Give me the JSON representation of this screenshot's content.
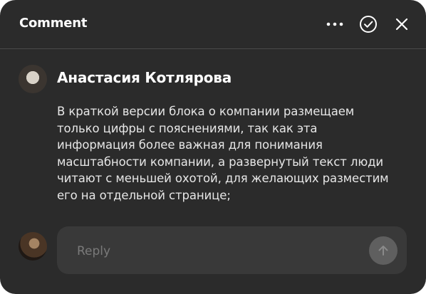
{
  "header": {
    "title": "Comment",
    "icons": [
      "more-icon",
      "check-circle-icon",
      "close-icon"
    ]
  },
  "comment": {
    "author": "Анастасия Котлярова",
    "text": "В краткой версии блока о компании размещаем только  цифры с пояснениями, так как эта информация более важная для понимания масштабности компании, а развернутый текст люди читают с меньшей охотой, для желающих разместим его на отдельной странице;"
  },
  "reply": {
    "placeholder": "Reply",
    "value": "",
    "send_icon": "arrow-up-icon"
  },
  "colors": {
    "panel_bg": "#2b2b2b",
    "reply_bg": "#393939",
    "send_bg": "#5f5f5f",
    "text": "#ffffff",
    "placeholder": "#7a7a7a"
  }
}
